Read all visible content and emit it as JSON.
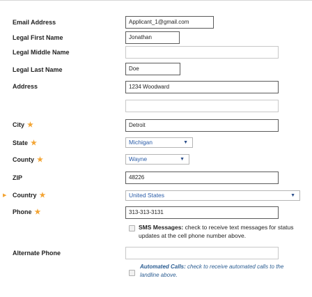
{
  "form": {
    "email_label": "Email Address",
    "email_value": "Applicant_1@gmail.com",
    "first_name_label": "Legal First Name",
    "first_name_value": "Jonathan",
    "middle_name_label": "Legal Middle Name",
    "middle_name_value": "",
    "last_name_label": "Legal Last Name",
    "last_name_value": "Doe",
    "address_label": "Address",
    "address_line1_value": "1234 Woodward",
    "address_line2_value": "",
    "city_label": "City",
    "city_value": "Detroit",
    "state_label": "State",
    "state_value": "Michigan",
    "county_label": "County",
    "county_value": "Wayne",
    "zip_label": "ZIP",
    "zip_value": "48226",
    "country_label": "Country",
    "country_value": "United States",
    "phone_label": "Phone",
    "phone_value": "313-313-3131",
    "sms_bold": "SMS Messages:",
    "sms_text": " check to receive text messages for status updates at the cell phone number above.",
    "alt_phone_label": "Alternate Phone",
    "alt_phone_value": "",
    "auto_calls_bold": "Automated Calls:",
    "auto_calls_text": " check to receive automated calls to the landline above."
  },
  "icons": {
    "required": "star",
    "dropdown": "down-triangle",
    "pointer": "right-triangle"
  },
  "colors": {
    "required_star": "#f3a433",
    "select_text": "#2a5ca8",
    "italic_note": "#2b5d92"
  }
}
